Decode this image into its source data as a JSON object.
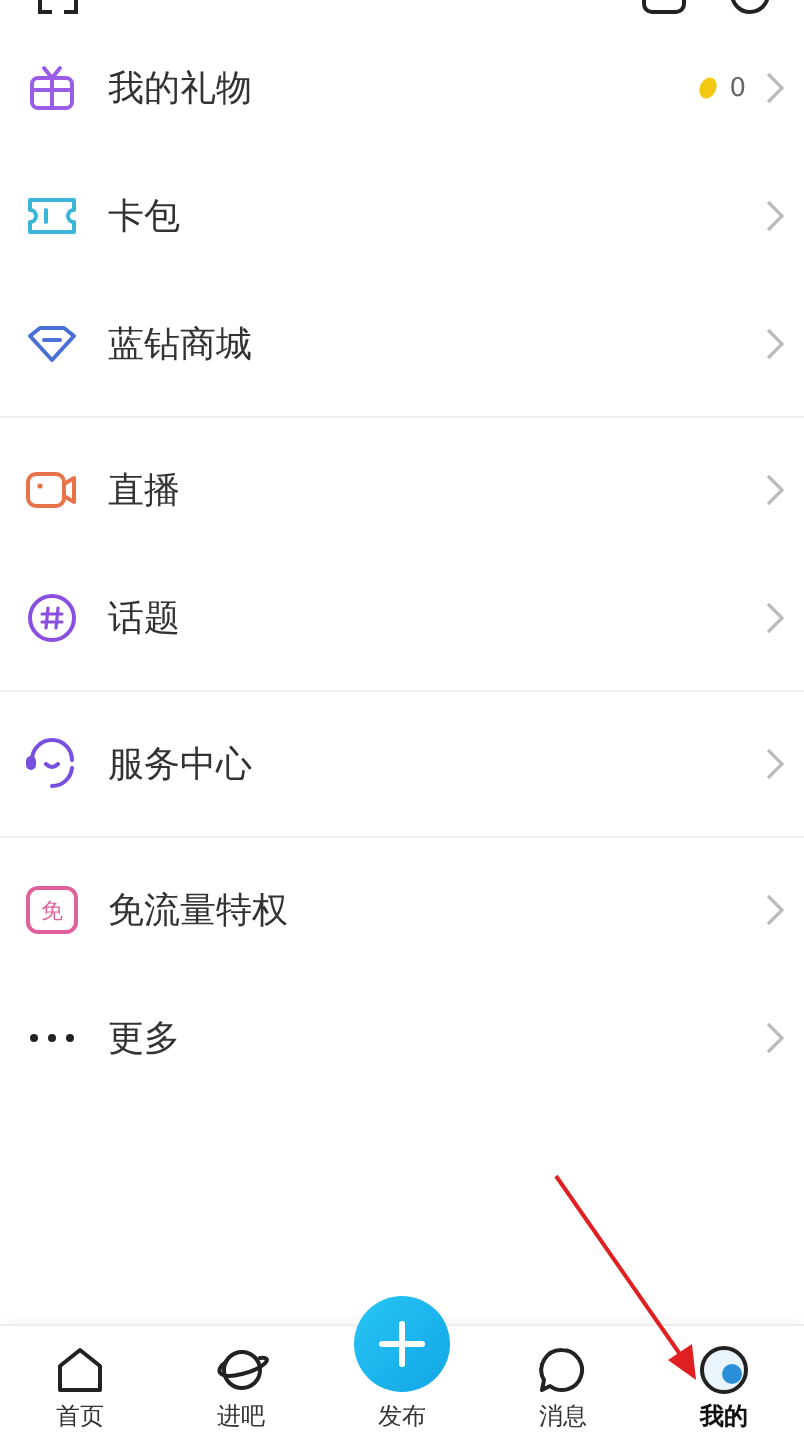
{
  "sections": [
    {
      "items": [
        {
          "kind": "gift",
          "label": "我的礼物",
          "count": "0"
        },
        {
          "kind": "card",
          "label": "卡包"
        },
        {
          "kind": "diamond",
          "label": "蓝钻商城"
        }
      ]
    },
    {
      "items": [
        {
          "kind": "live",
          "label": "直播"
        },
        {
          "kind": "topic",
          "label": "话题"
        }
      ]
    },
    {
      "items": [
        {
          "kind": "service",
          "label": "服务中心"
        }
      ]
    },
    {
      "items": [
        {
          "kind": "free",
          "label": "免流量特权",
          "badge_text": "免"
        },
        {
          "kind": "more",
          "label": "更多"
        }
      ]
    }
  ],
  "tab_bar": [
    {
      "kind": "home",
      "label": "首页",
      "selected": false
    },
    {
      "kind": "planet",
      "label": "进吧",
      "selected": false
    },
    {
      "kind": "publish",
      "label": "发布",
      "selected": false
    },
    {
      "kind": "message",
      "label": "消息",
      "selected": false
    },
    {
      "kind": "avatar",
      "label": "我的",
      "selected": true
    }
  ]
}
